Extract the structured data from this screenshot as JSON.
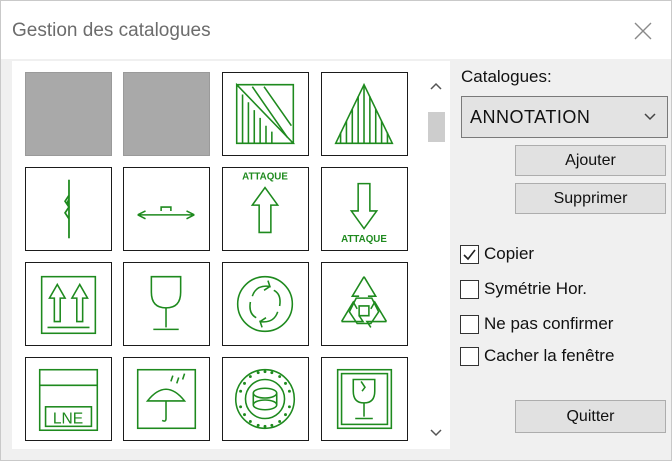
{
  "window": {
    "title": "Gestion des catalogues"
  },
  "catalog": {
    "label": "Catalogues:",
    "selected": "ANNOTATION",
    "add_label": "Ajouter",
    "delete_label": "Supprimer"
  },
  "options": [
    {
      "label": "Copier",
      "checked": true
    },
    {
      "label": "Symétrie Hor.",
      "checked": false
    },
    {
      "label": "Ne pas confirmer",
      "checked": false
    },
    {
      "label": "Cacher la fenêtre",
      "checked": false
    }
  ],
  "quit_label": "Quitter",
  "symbols": {
    "attack_up_text": "ATTAQUE",
    "attack_down_text": "ATTAQUE",
    "lne_text": "LNE",
    "items": [
      "empty-slot",
      "empty-slot",
      "hatched-triangle-right",
      "hatched-triangle",
      "section-line-vertical",
      "dimension-arrow",
      "attack-arrow-up",
      "attack-arrow-down",
      "this-way-up-arrows",
      "fragile-glass",
      "green-dot-recycling",
      "recycling-symbol",
      "lne-label",
      "keep-dry-umbrella",
      "round-seal-stamp",
      "fragile-glass-box"
    ]
  },
  "colors": {
    "symbol_green": "#1e8a1e",
    "empty_slot": "#a9a9a9",
    "dialog_bg": "#f0f0f0"
  }
}
